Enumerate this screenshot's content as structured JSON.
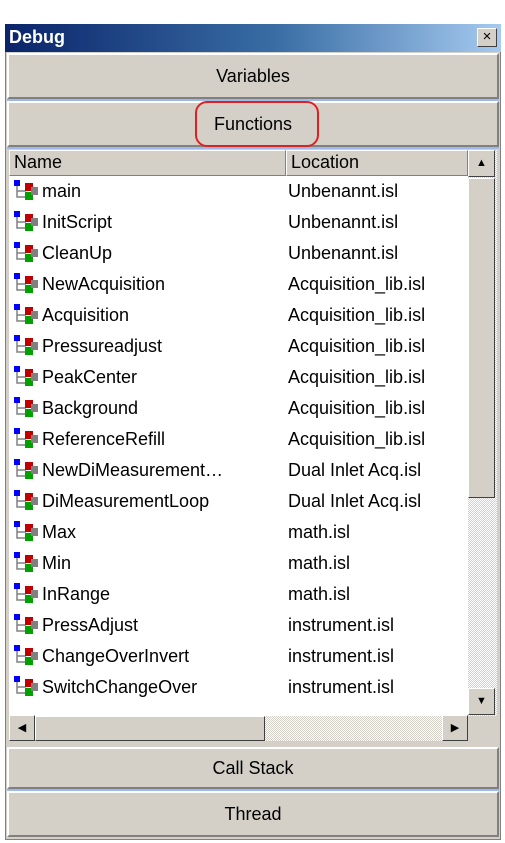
{
  "window": {
    "title": "Debug",
    "close_glyph": "×"
  },
  "buttons": {
    "variables": "Variables",
    "functions": "Functions",
    "call_stack": "Call Stack",
    "thread": "Thread"
  },
  "list": {
    "columns": [
      "Name",
      "Location"
    ],
    "rows": [
      {
        "name": "main",
        "location": "Unbenannt.isl"
      },
      {
        "name": "InitScript",
        "location": "Unbenannt.isl"
      },
      {
        "name": "CleanUp",
        "location": "Unbenannt.isl"
      },
      {
        "name": "NewAcquisition",
        "location": "Acquisition_lib.isl"
      },
      {
        "name": "Acquisition",
        "location": "Acquisition_lib.isl"
      },
      {
        "name": "Pressureadjust",
        "location": "Acquisition_lib.isl"
      },
      {
        "name": "PeakCenter",
        "location": "Acquisition_lib.isl"
      },
      {
        "name": "Background",
        "location": "Acquisition_lib.isl"
      },
      {
        "name": "ReferenceRefill",
        "location": "Acquisition_lib.isl"
      },
      {
        "name": "NewDiMeasurement…",
        "location": "Dual Inlet Acq.isl"
      },
      {
        "name": "DiMeasurementLoop",
        "location": "Dual Inlet Acq.isl"
      },
      {
        "name": "Max",
        "location": "math.isl"
      },
      {
        "name": "Min",
        "location": "math.isl"
      },
      {
        "name": "InRange",
        "location": "math.isl"
      },
      {
        "name": "PressAdjust",
        "location": "instrument.isl"
      },
      {
        "name": "ChangeOverInvert",
        "location": "instrument.isl"
      },
      {
        "name": "SwitchChangeOver",
        "location": "instrument.isl"
      }
    ],
    "row_icon": "function-tree-icon"
  },
  "scrollbar_glyphs": {
    "up": "▲",
    "down": "▼",
    "left": "◀",
    "right": "▶"
  },
  "colors": {
    "title_start": "#0a246a",
    "title_end": "#a6caf0",
    "face": "#d4d0c8",
    "highlight_circle": "#e02020"
  }
}
